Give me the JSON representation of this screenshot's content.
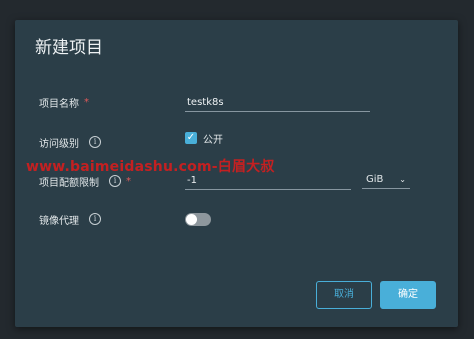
{
  "dialog": {
    "title": "新建项目",
    "project_name": {
      "label": "项目名称",
      "required_mark": "*",
      "value": "testk8s"
    },
    "access_level": {
      "label": "访问级别",
      "info": "i",
      "checkbox_label": "公开",
      "checked": true
    },
    "quota": {
      "label": "项目配额限制",
      "info": "i",
      "required_mark": "*",
      "value": "-1",
      "unit": "GiB"
    },
    "mirror_proxy": {
      "label": "镜像代理",
      "info": "i",
      "enabled": false
    },
    "cancel_label": "取消",
    "ok_label": "确定"
  },
  "watermark": "www.baimeidashu.com-白眉大叔",
  "colors": {
    "accent": "#49afd9",
    "dialog_bg": "#2b3e48",
    "required": "#e05a5a"
  }
}
